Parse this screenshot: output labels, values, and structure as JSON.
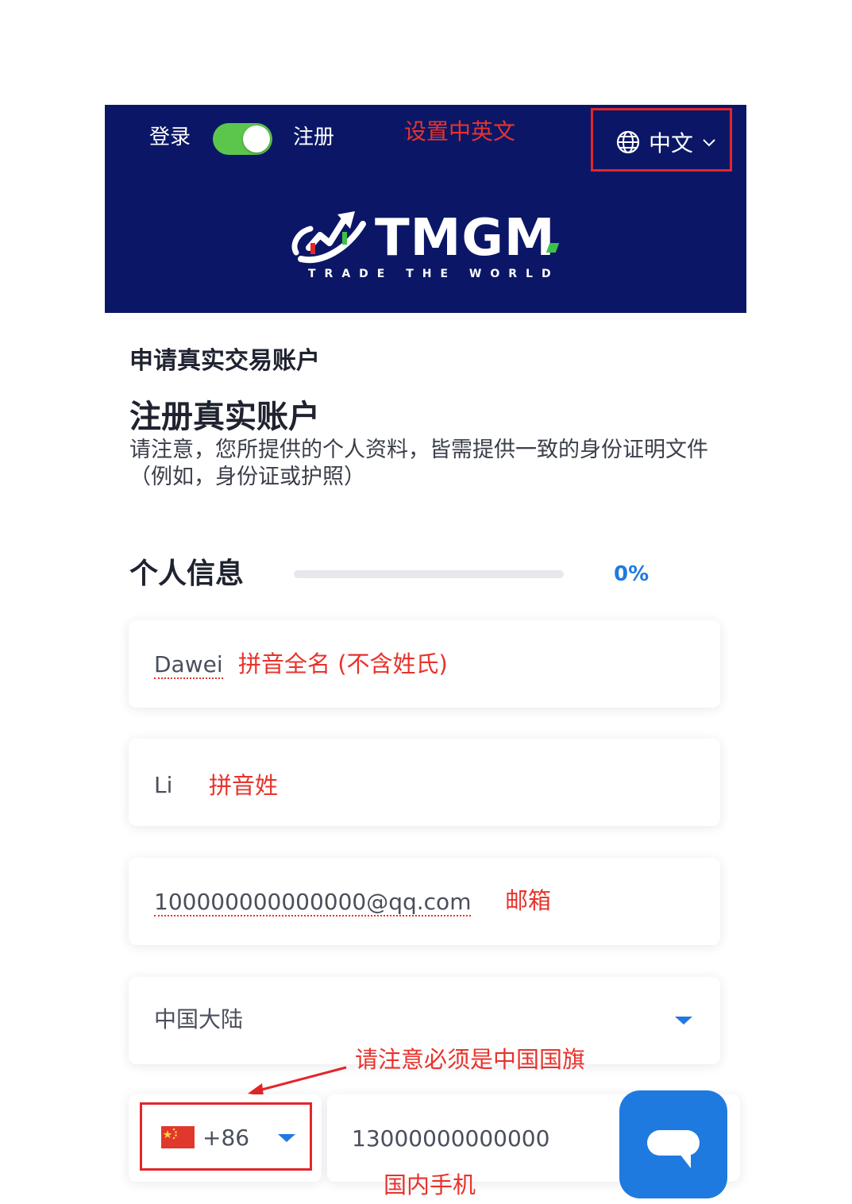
{
  "header": {
    "login_label": "登录",
    "register_label": "注册",
    "toggle_state": "on",
    "language_annotation": "设置中英文",
    "language_label": "中文",
    "logo_text": "TMGM",
    "tagline": "TRADE THE WORLD"
  },
  "form": {
    "subtitle": "申请真实交易账户",
    "title": "注册真实账户",
    "notice": "请注意，您所提供的个人资料，皆需提供一致的身份证明文件（例如，身份证或护照）",
    "section_title": "个人信息",
    "progress_text": "0%",
    "progress_value": 0,
    "fields": {
      "first_name": {
        "value": "Dawei",
        "annotation": "拼音全名 (不含姓氏)"
      },
      "last_name": {
        "value": "Li",
        "annotation": "拼音姓"
      },
      "email": {
        "value": "100000000000000@qq.com",
        "annotation": "邮箱"
      },
      "country": {
        "value": "中国大陆"
      },
      "country_code": {
        "value": "+86",
        "annotation": "请注意必须是中国国旗"
      },
      "phone": {
        "value": "13000000000000",
        "annotation": "国内手机"
      }
    }
  },
  "colors": {
    "header_bg": "#0b1766",
    "accent_blue": "#1f7ae0",
    "toggle_green": "#5cc64c",
    "annotation_red": "#e8332c"
  },
  "icons": [
    "globe-icon",
    "chevron-down-icon",
    "logo-icon",
    "dropdown-arrow-icon",
    "china-flag-icon",
    "chat-icon",
    "annotation-arrow-icon"
  ]
}
